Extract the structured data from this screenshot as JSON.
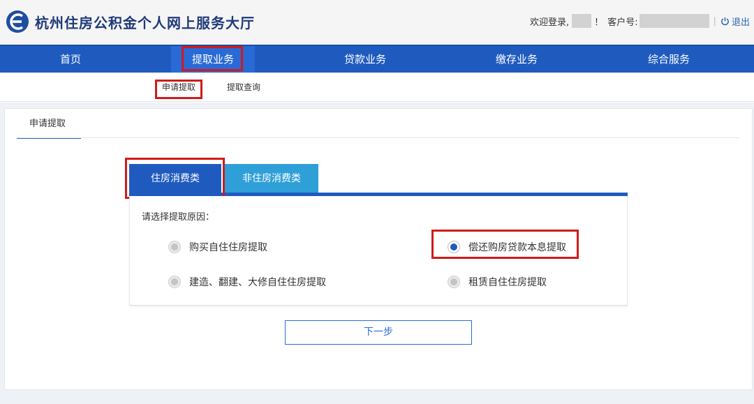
{
  "header": {
    "site_title": "杭州住房公积金个人网上服务大厅",
    "welcome_prefix": "欢迎登录,",
    "welcome_suffix": "！",
    "customer_id_label": "客户号:",
    "separator": "|",
    "logout_label": "退出"
  },
  "main_nav": {
    "items": [
      {
        "label": "首页"
      },
      {
        "label": "提取业务",
        "active": true
      },
      {
        "label": "贷款业务"
      },
      {
        "label": "缴存业务"
      },
      {
        "label": "综合服务"
      }
    ]
  },
  "sub_nav": {
    "items": [
      {
        "label": "申请提取",
        "active": true
      },
      {
        "label": "提取查询"
      }
    ]
  },
  "panel": {
    "title": "申请提取"
  },
  "tabs": [
    {
      "label": "住房消费类",
      "active": true
    },
    {
      "label": "非住房消费类"
    }
  ],
  "form": {
    "prompt": "请选择提取原因：",
    "options": [
      {
        "label": "购买自住住房提取",
        "checked": false
      },
      {
        "label": "偿还购房贷款本息提取",
        "checked": true
      },
      {
        "label": "建造、翻建、大修自住住房提取",
        "checked": false
      },
      {
        "label": "租赁自住住房提取",
        "checked": false
      }
    ]
  },
  "actions": {
    "next_label": "下一步"
  },
  "colors": {
    "nav_blue": "#1f5bbf",
    "tab_light_blue": "#2f9fd8",
    "highlight_red": "#d11a1a"
  },
  "icons": {
    "logo": "provident-fund-logo",
    "logout": "power-icon"
  }
}
